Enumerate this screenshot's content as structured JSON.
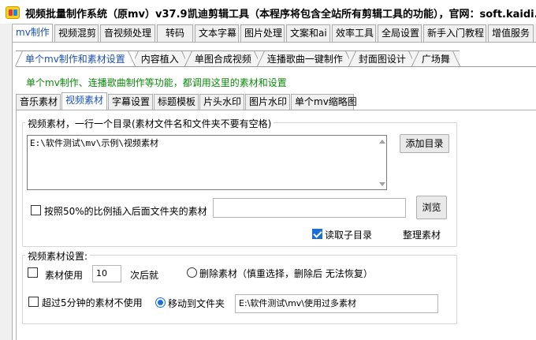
{
  "titlebar": {
    "title": "视频批量制作系统（原mv）v37.9",
    "subtitle": "凯迪剪辑工具（本程序将包含全站所有剪辑工具的功能），官网：soft.kaidi.vip"
  },
  "main_tabs": [
    "mv制作",
    "视频混剪",
    "音视频处理",
    "转码",
    "文本字幕",
    "图片处理",
    "文案和ai",
    "效率工具",
    "全局设置",
    "新手入门教程",
    "增值服务"
  ],
  "sub_tabs": [
    "单个mv制作和素材设置",
    "内容植入",
    "单图合成视频",
    "连播歌曲一键制作",
    "封面图设计",
    "广场舞"
  ],
  "description": "单个mv制作、连播歌曲制作等功能，都调用这里的素材和设置",
  "material_tabs": [
    "音乐素材",
    "视频素材",
    "字幕设置",
    "标题模板",
    "片头水印",
    "图片水印",
    "单个mv缩略图"
  ],
  "video_material": {
    "group_label": "视频素材，一行一个目录(素材文件名和文件夹不要有空格)",
    "directory_text": "E:\\软件测试\\mv\\示例\\视频素材",
    "add_dir_button": "添加目录",
    "insert_ratio_label": "按照50%的比例插入后面文件夹的素材",
    "insert_ratio_checked": false,
    "insert_folder_value": "",
    "browse_button": "浏览",
    "read_subdir_label": "读取子目录",
    "read_subdir_checked": true,
    "organize_label": "整理素材"
  },
  "video_settings": {
    "group_label": "视频素材设置:",
    "use_count_label": "素材使用",
    "use_count_checked": false,
    "use_count_value": "10",
    "after_label": "次后就",
    "delete_label": "删除素材（慎重选择，删除后 无法恢复）",
    "delete_selected": false,
    "over5_label": "超过5分钟的素材不使用",
    "over5_checked": false,
    "move_label": "移动到文件夹",
    "move_selected": true,
    "move_path": "E:\\软件测试\\mv\\使用过多素材"
  }
}
